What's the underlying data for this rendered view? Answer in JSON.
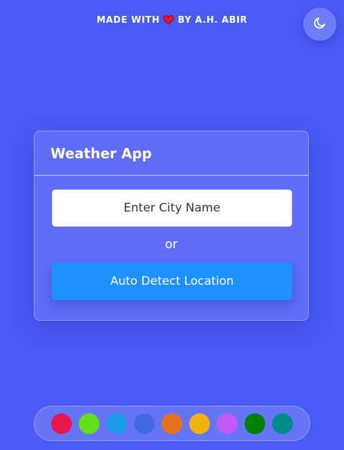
{
  "credit": {
    "prefix": "MADE WITH",
    "suffix": "BY A.H. ABIR",
    "heart_icon": "heart-icon",
    "heart_color": "#e8112d"
  },
  "theme_toggle": {
    "icon": "moon-icon"
  },
  "card": {
    "title": "Weather App",
    "city_input": {
      "placeholder": "Enter City Name",
      "value": ""
    },
    "or_text": "or",
    "detect_button": "Auto Detect Location"
  },
  "palette": {
    "colors": [
      "#e8174b",
      "#62e01a",
      "#1e9be8",
      "#4169e1",
      "#e8731e",
      "#f2b30f",
      "#c259f9",
      "#008000",
      "#008b8b"
    ]
  },
  "theme": {
    "background": "#4a5af5",
    "card": "#5e6cf7",
    "accent": "#1e90ff"
  }
}
